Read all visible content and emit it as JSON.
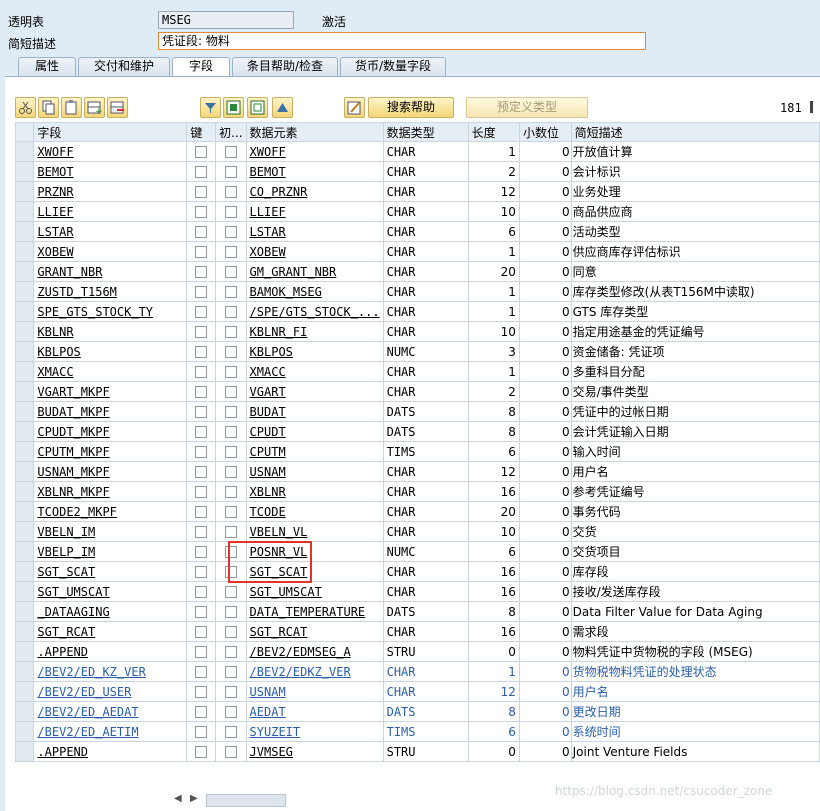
{
  "header": {
    "table_label": "透明表",
    "table_name": "MSEG",
    "status": "激活",
    "desc_label": "简短描述",
    "desc_value": "凭证段: 物料"
  },
  "tabs": [
    "属性",
    "交付和维护",
    "字段",
    "条目帮助/检查",
    "货币/数量字段"
  ],
  "active_tab": "字段",
  "toolbar": {
    "search_help": "搜索帮助",
    "predefined_type": "预定义类型",
    "count": "181"
  },
  "columns": [
    "字段",
    "键",
    "初...",
    "数据元素",
    "数据类型",
    "长度",
    "小数位",
    "简短描述"
  ],
  "rows": [
    {
      "field": "XWOFF",
      "elem": "XWOFF",
      "type": "CHAR",
      "len": "1",
      "dec": "0",
      "desc": "开放值计算"
    },
    {
      "field": "BEMOT",
      "elem": "BEMOT",
      "type": "CHAR",
      "len": "2",
      "dec": "0",
      "desc": "会计标识"
    },
    {
      "field": "PRZNR",
      "elem": "CO_PRZNR",
      "type": "CHAR",
      "len": "12",
      "dec": "0",
      "desc": "业务处理"
    },
    {
      "field": "LLIEF",
      "elem": "LLIEF",
      "type": "CHAR",
      "len": "10",
      "dec": "0",
      "desc": "商品供应商"
    },
    {
      "field": "LSTAR",
      "elem": "LSTAR",
      "type": "CHAR",
      "len": "6",
      "dec": "0",
      "desc": "活动类型"
    },
    {
      "field": "XOBEW",
      "elem": "XOBEW",
      "type": "CHAR",
      "len": "1",
      "dec": "0",
      "desc": "供应商库存评估标识"
    },
    {
      "field": "GRANT_NBR",
      "elem": "GM_GRANT_NBR",
      "type": "CHAR",
      "len": "20",
      "dec": "0",
      "desc": "同意"
    },
    {
      "field": "ZUSTD_T156M",
      "elem": "BAMOK_MSEG",
      "type": "CHAR",
      "len": "1",
      "dec": "0",
      "desc": "库存类型修改(从表T156M中读取)"
    },
    {
      "field": "SPE_GTS_STOCK_TY",
      "elem": "/SPE/GTS_STOCK_...",
      "type": "CHAR",
      "len": "1",
      "dec": "0",
      "desc": "GTS 库存类型"
    },
    {
      "field": "KBLNR",
      "elem": "KBLNR_FI",
      "type": "CHAR",
      "len": "10",
      "dec": "0",
      "desc": "指定用途基金的凭证编号"
    },
    {
      "field": "KBLPOS",
      "elem": "KBLPOS",
      "type": "NUMC",
      "len": "3",
      "dec": "0",
      "desc": "资金储备: 凭证项"
    },
    {
      "field": "XMACC",
      "elem": "XMACC",
      "type": "CHAR",
      "len": "1",
      "dec": "0",
      "desc": "多重科目分配"
    },
    {
      "field": "VGART_MKPF",
      "elem": "VGART",
      "type": "CHAR",
      "len": "2",
      "dec": "0",
      "desc": "交易/事件类型"
    },
    {
      "field": "BUDAT_MKPF",
      "elem": "BUDAT",
      "type": "DATS",
      "len": "8",
      "dec": "0",
      "desc": "凭证中的过帐日期"
    },
    {
      "field": "CPUDT_MKPF",
      "elem": "CPUDT",
      "type": "DATS",
      "len": "8",
      "dec": "0",
      "desc": "会计凭证输入日期"
    },
    {
      "field": "CPUTM_MKPF",
      "elem": "CPUTM",
      "type": "TIMS",
      "len": "6",
      "dec": "0",
      "desc": "输入时间"
    },
    {
      "field": "USNAM_MKPF",
      "elem": "USNAM",
      "type": "CHAR",
      "len": "12",
      "dec": "0",
      "desc": "用户名"
    },
    {
      "field": "XBLNR_MKPF",
      "elem": "XBLNR",
      "type": "CHAR",
      "len": "16",
      "dec": "0",
      "desc": "参考凭证编号"
    },
    {
      "field": "TCODE2_MKPF",
      "elem": "TCODE",
      "type": "CHAR",
      "len": "20",
      "dec": "0",
      "desc": "事务代码"
    },
    {
      "field": "VBELN_IM",
      "elem": "VBELN_VL",
      "type": "CHAR",
      "len": "10",
      "dec": "0",
      "desc": "交货"
    },
    {
      "field": "VBELP_IM",
      "elem": "POSNR_VL",
      "type": "NUMC",
      "len": "6",
      "dec": "0",
      "desc": "交货项目"
    },
    {
      "field": "SGT_SCAT",
      "elem": "SGT_SCAT",
      "type": "CHAR",
      "len": "16",
      "dec": "0",
      "desc": "库存段"
    },
    {
      "field": "SGT_UMSCAT",
      "elem": "SGT_UMSCAT",
      "type": "CHAR",
      "len": "16",
      "dec": "0",
      "desc": "接收/发送库存段"
    },
    {
      "field": "_DATAAGING",
      "elem": "DATA_TEMPERATURE",
      "type": "DATS",
      "len": "8",
      "dec": "0",
      "desc": "Data Filter Value for Data Aging"
    },
    {
      "field": "SGT_RCAT",
      "elem": "SGT_RCAT",
      "type": "CHAR",
      "len": "16",
      "dec": "0",
      "desc": "需求段"
    },
    {
      "field": ".APPEND",
      "elem": "/BEV2/EDMSEG_A",
      "type": "STRU",
      "len": "0",
      "dec": "0",
      "desc": "物料凭证中货物税的字段 (MSEG)"
    },
    {
      "field": "/BEV2/ED_KZ_VER",
      "elem": "/BEV2/EDKZ_VER",
      "type": "CHAR",
      "len": "1",
      "dec": "0",
      "desc": "货物税物料凭证的处理状态",
      "blue": true
    },
    {
      "field": "/BEV2/ED_USER",
      "elem": "USNAM",
      "type": "CHAR",
      "len": "12",
      "dec": "0",
      "desc": "用户名",
      "blue": true
    },
    {
      "field": "/BEV2/ED_AEDAT",
      "elem": "AEDAT",
      "type": "DATS",
      "len": "8",
      "dec": "0",
      "desc": "更改日期",
      "blue": true
    },
    {
      "field": "/BEV2/ED_AETIM",
      "elem": "SYUZEIT",
      "type": "TIMS",
      "len": "6",
      "dec": "0",
      "desc": "系统时间",
      "blue": true
    },
    {
      "field": ".APPEND",
      "elem": "JVMSEG",
      "type": "STRU",
      "len": "0",
      "dec": "0",
      "desc": "Joint Venture Fields"
    }
  ],
  "watermark": "https://blog.csdn.net/csucoder_zone",
  "colors": {
    "highlight": "#e0342b",
    "blue_text": "#2a5ea9"
  }
}
